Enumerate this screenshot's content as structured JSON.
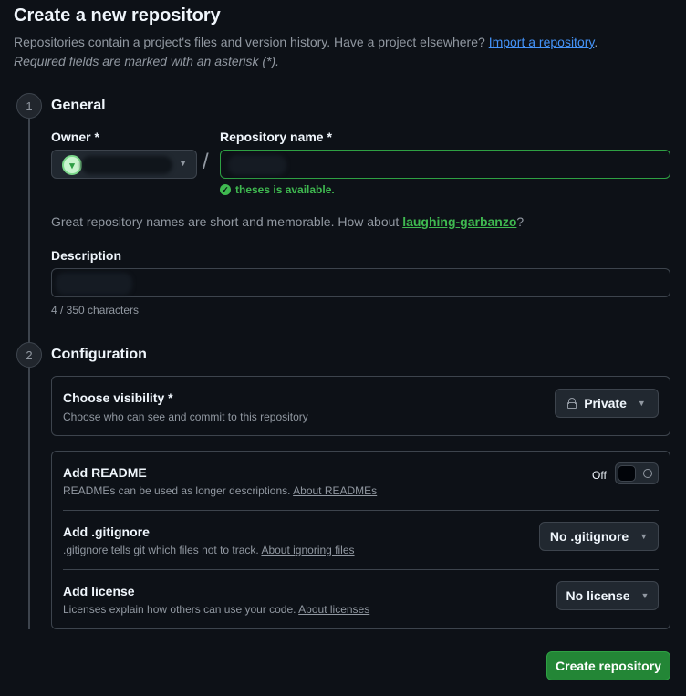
{
  "page": {
    "title": "Create a new repository",
    "intro_text": "Repositories contain a project's files and version history. Have a project elsewhere? ",
    "import_link": "Import a repository",
    "intro_period": ".",
    "required_note": "Required fields are marked with an asterisk (*)."
  },
  "general": {
    "step_number": "1",
    "title": "General",
    "owner_label": "Owner *",
    "repo_label": "Repository name *",
    "slash": "/",
    "availability": "theses is available.",
    "suggestion_prefix": "Great repository names are short and memorable. How about ",
    "suggestion_name": "laughing-garbanzo",
    "suggestion_suffix": "?",
    "description_label": "Description",
    "char_count": "4 / 350 characters"
  },
  "configuration": {
    "step_number": "2",
    "title": "Configuration",
    "visibility": {
      "title": "Choose visibility *",
      "subtitle": "Choose who can see and commit to this repository",
      "value": "Private"
    },
    "readme": {
      "title": "Add README",
      "subtitle": "READMEs can be used as longer descriptions. ",
      "link": "About READMEs",
      "toggle_label": "Off"
    },
    "gitignore": {
      "title": "Add .gitignore",
      "subtitle": ".gitignore tells git which files not to track. ",
      "link": "About ignoring files",
      "value": "No .gitignore"
    },
    "license": {
      "title": "Add license",
      "subtitle": "Licenses explain how others can use your code. ",
      "link": "About licenses",
      "value": "No license"
    }
  },
  "actions": {
    "create_label": "Create repository"
  }
}
